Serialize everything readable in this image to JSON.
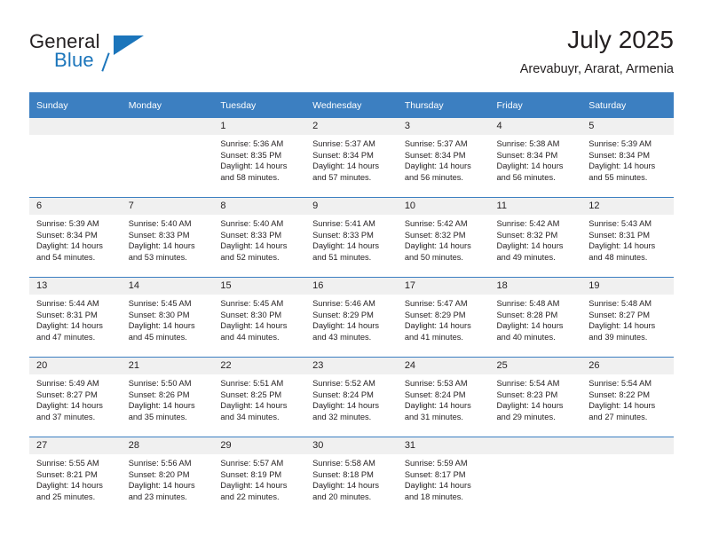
{
  "brand": {
    "name_part1": "General",
    "name_part2": "Blue",
    "logo_icon": "triangle-logo-icon"
  },
  "header": {
    "title": "July 2025",
    "subtitle": "Arevabuyr, Ararat, Armenia"
  },
  "colors": {
    "header_blue": "#3c7fc1",
    "brand_blue": "#1b75bb",
    "daynum_band": "#f0f0f0",
    "text": "#231f20"
  },
  "weekday_headers": [
    "Sunday",
    "Monday",
    "Tuesday",
    "Wednesday",
    "Thursday",
    "Friday",
    "Saturday"
  ],
  "weeks": [
    [
      {
        "day": "",
        "empty": true
      },
      {
        "day": "",
        "empty": true
      },
      {
        "day": "1",
        "sunrise": "Sunrise: 5:36 AM",
        "sunset": "Sunset: 8:35 PM",
        "daylight1": "Daylight: 14 hours",
        "daylight2": "and 58 minutes."
      },
      {
        "day": "2",
        "sunrise": "Sunrise: 5:37 AM",
        "sunset": "Sunset: 8:34 PM",
        "daylight1": "Daylight: 14 hours",
        "daylight2": "and 57 minutes."
      },
      {
        "day": "3",
        "sunrise": "Sunrise: 5:37 AM",
        "sunset": "Sunset: 8:34 PM",
        "daylight1": "Daylight: 14 hours",
        "daylight2": "and 56 minutes."
      },
      {
        "day": "4",
        "sunrise": "Sunrise: 5:38 AM",
        "sunset": "Sunset: 8:34 PM",
        "daylight1": "Daylight: 14 hours",
        "daylight2": "and 56 minutes."
      },
      {
        "day": "5",
        "sunrise": "Sunrise: 5:39 AM",
        "sunset": "Sunset: 8:34 PM",
        "daylight1": "Daylight: 14 hours",
        "daylight2": "and 55 minutes."
      }
    ],
    [
      {
        "day": "6",
        "sunrise": "Sunrise: 5:39 AM",
        "sunset": "Sunset: 8:34 PM",
        "daylight1": "Daylight: 14 hours",
        "daylight2": "and 54 minutes."
      },
      {
        "day": "7",
        "sunrise": "Sunrise: 5:40 AM",
        "sunset": "Sunset: 8:33 PM",
        "daylight1": "Daylight: 14 hours",
        "daylight2": "and 53 minutes."
      },
      {
        "day": "8",
        "sunrise": "Sunrise: 5:40 AM",
        "sunset": "Sunset: 8:33 PM",
        "daylight1": "Daylight: 14 hours",
        "daylight2": "and 52 minutes."
      },
      {
        "day": "9",
        "sunrise": "Sunrise: 5:41 AM",
        "sunset": "Sunset: 8:33 PM",
        "daylight1": "Daylight: 14 hours",
        "daylight2": "and 51 minutes."
      },
      {
        "day": "10",
        "sunrise": "Sunrise: 5:42 AM",
        "sunset": "Sunset: 8:32 PM",
        "daylight1": "Daylight: 14 hours",
        "daylight2": "and 50 minutes."
      },
      {
        "day": "11",
        "sunrise": "Sunrise: 5:42 AM",
        "sunset": "Sunset: 8:32 PM",
        "daylight1": "Daylight: 14 hours",
        "daylight2": "and 49 minutes."
      },
      {
        "day": "12",
        "sunrise": "Sunrise: 5:43 AM",
        "sunset": "Sunset: 8:31 PM",
        "daylight1": "Daylight: 14 hours",
        "daylight2": "and 48 minutes."
      }
    ],
    [
      {
        "day": "13",
        "sunrise": "Sunrise: 5:44 AM",
        "sunset": "Sunset: 8:31 PM",
        "daylight1": "Daylight: 14 hours",
        "daylight2": "and 47 minutes."
      },
      {
        "day": "14",
        "sunrise": "Sunrise: 5:45 AM",
        "sunset": "Sunset: 8:30 PM",
        "daylight1": "Daylight: 14 hours",
        "daylight2": "and 45 minutes."
      },
      {
        "day": "15",
        "sunrise": "Sunrise: 5:45 AM",
        "sunset": "Sunset: 8:30 PM",
        "daylight1": "Daylight: 14 hours",
        "daylight2": "and 44 minutes."
      },
      {
        "day": "16",
        "sunrise": "Sunrise: 5:46 AM",
        "sunset": "Sunset: 8:29 PM",
        "daylight1": "Daylight: 14 hours",
        "daylight2": "and 43 minutes."
      },
      {
        "day": "17",
        "sunrise": "Sunrise: 5:47 AM",
        "sunset": "Sunset: 8:29 PM",
        "daylight1": "Daylight: 14 hours",
        "daylight2": "and 41 minutes."
      },
      {
        "day": "18",
        "sunrise": "Sunrise: 5:48 AM",
        "sunset": "Sunset: 8:28 PM",
        "daylight1": "Daylight: 14 hours",
        "daylight2": "and 40 minutes."
      },
      {
        "day": "19",
        "sunrise": "Sunrise: 5:48 AM",
        "sunset": "Sunset: 8:27 PM",
        "daylight1": "Daylight: 14 hours",
        "daylight2": "and 39 minutes."
      }
    ],
    [
      {
        "day": "20",
        "sunrise": "Sunrise: 5:49 AM",
        "sunset": "Sunset: 8:27 PM",
        "daylight1": "Daylight: 14 hours",
        "daylight2": "and 37 minutes."
      },
      {
        "day": "21",
        "sunrise": "Sunrise: 5:50 AM",
        "sunset": "Sunset: 8:26 PM",
        "daylight1": "Daylight: 14 hours",
        "daylight2": "and 35 minutes."
      },
      {
        "day": "22",
        "sunrise": "Sunrise: 5:51 AM",
        "sunset": "Sunset: 8:25 PM",
        "daylight1": "Daylight: 14 hours",
        "daylight2": "and 34 minutes."
      },
      {
        "day": "23",
        "sunrise": "Sunrise: 5:52 AM",
        "sunset": "Sunset: 8:24 PM",
        "daylight1": "Daylight: 14 hours",
        "daylight2": "and 32 minutes."
      },
      {
        "day": "24",
        "sunrise": "Sunrise: 5:53 AM",
        "sunset": "Sunset: 8:24 PM",
        "daylight1": "Daylight: 14 hours",
        "daylight2": "and 31 minutes."
      },
      {
        "day": "25",
        "sunrise": "Sunrise: 5:54 AM",
        "sunset": "Sunset: 8:23 PM",
        "daylight1": "Daylight: 14 hours",
        "daylight2": "and 29 minutes."
      },
      {
        "day": "26",
        "sunrise": "Sunrise: 5:54 AM",
        "sunset": "Sunset: 8:22 PM",
        "daylight1": "Daylight: 14 hours",
        "daylight2": "and 27 minutes."
      }
    ],
    [
      {
        "day": "27",
        "sunrise": "Sunrise: 5:55 AM",
        "sunset": "Sunset: 8:21 PM",
        "daylight1": "Daylight: 14 hours",
        "daylight2": "and 25 minutes."
      },
      {
        "day": "28",
        "sunrise": "Sunrise: 5:56 AM",
        "sunset": "Sunset: 8:20 PM",
        "daylight1": "Daylight: 14 hours",
        "daylight2": "and 23 minutes."
      },
      {
        "day": "29",
        "sunrise": "Sunrise: 5:57 AM",
        "sunset": "Sunset: 8:19 PM",
        "daylight1": "Daylight: 14 hours",
        "daylight2": "and 22 minutes."
      },
      {
        "day": "30",
        "sunrise": "Sunrise: 5:58 AM",
        "sunset": "Sunset: 8:18 PM",
        "daylight1": "Daylight: 14 hours",
        "daylight2": "and 20 minutes."
      },
      {
        "day": "31",
        "sunrise": "Sunrise: 5:59 AM",
        "sunset": "Sunset: 8:17 PM",
        "daylight1": "Daylight: 14 hours",
        "daylight2": "and 18 minutes."
      },
      {
        "day": "",
        "empty": true
      },
      {
        "day": "",
        "empty": true
      }
    ]
  ]
}
